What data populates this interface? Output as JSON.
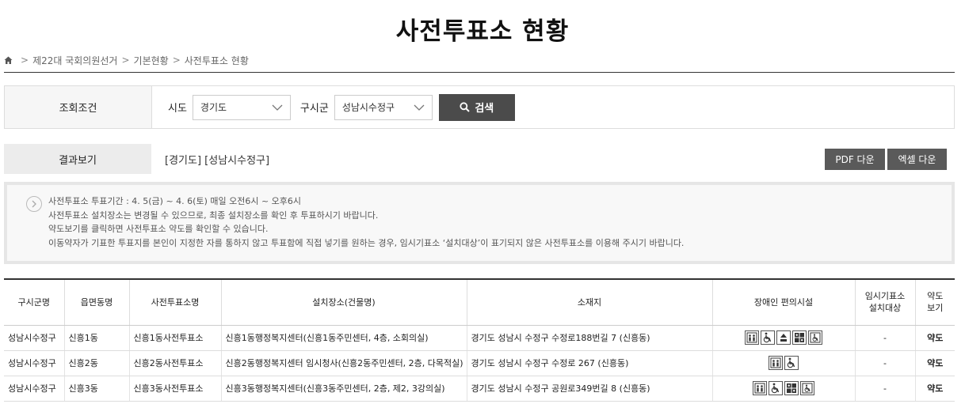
{
  "page": {
    "title": "사전투표소 현황"
  },
  "breadcrumb": {
    "items": [
      "제22대 국회의원선거",
      "기본현황",
      "사전투표소 현황"
    ],
    "sep": ">"
  },
  "search": {
    "cond_label": "조회조건",
    "sido_label": "시도",
    "sido_value": "경기도",
    "gu_label": "구시군",
    "gu_value": "성남시수정구",
    "button_label": "검색"
  },
  "result": {
    "label": "결과보기",
    "summary": "[경기도] [성남시수정구]",
    "pdf_label": "PDF 다운",
    "excel_label": "엑셀 다운"
  },
  "notice": {
    "lines": [
      "사전투표소 투표기간 : 4. 5(금) ~ 4. 6(토) 매일 오전6시 ~ 오후6시",
      "사전투표소 설치장소는 변경될 수 있으므로, 최종 설치장소를 확인 후 투표하시기 바랍니다.",
      "약도보기를 클릭하면 사전투표소 약도를 확인할 수 있습니다.",
      "이동약자가 기표한 투표지를 본인이 지정한 자를 통하지 않고 투표함에 직접 넣기를 원하는 경우, 임시기표소 ‘설치대상’이 표기되지 않은 사전투표소를 이용해 주시기 바랍니다."
    ]
  },
  "table": {
    "headers": [
      "구시군명",
      "읍면동명",
      "사전투표소명",
      "설치장소(건물명)",
      "소재지",
      "장애인 편의시설",
      "임시기표소\n설치대상",
      "약도\n보기"
    ],
    "header_lines": {
      "temp": [
        "임시기표소",
        "설치대상"
      ],
      "map": [
        "약도",
        "보기"
      ]
    },
    "rows": [
      {
        "gu": "성남시수정구",
        "dong": "신흥1동",
        "station": "신흥1동사전투표소",
        "place": "신흥1동행정복지센터(신흥1동주민센터, 4층, 소회의실)",
        "address": "경기도 성남시 수정구 수정로188번길 7 (신흥동)",
        "facilities": [
          "elevator-icon",
          "wheelchair-icon",
          "elevator-up-icon",
          "braille-icon",
          "accessible-toilet-icon"
        ],
        "temp": "-",
        "map": "약도"
      },
      {
        "gu": "성남시수정구",
        "dong": "신흥2동",
        "station": "신흥2동사전투표소",
        "place": "신흥2동행정복지센터 임시청사(신흥2동주민센터, 2층, 다목적실)",
        "address": "경기도 성남시 수정구 수정로 267 (신흥동)",
        "facilities": [
          "elevator-icon",
          "wheelchair-icon"
        ],
        "temp": "-",
        "map": "약도"
      },
      {
        "gu": "성남시수정구",
        "dong": "신흥3동",
        "station": "신흥3동사전투표소",
        "place": "신흥3동행정복지센터(신흥3동주민센터, 2층, 제2, 3강의실)",
        "address": "경기도 성남시 수정구 공원로349번길 8 (신흥동)",
        "facilities": [
          "elevator-icon",
          "wheelchair-icon",
          "braille-icon",
          "accessible-toilet-icon"
        ],
        "temp": "-",
        "map": "약도"
      }
    ]
  }
}
